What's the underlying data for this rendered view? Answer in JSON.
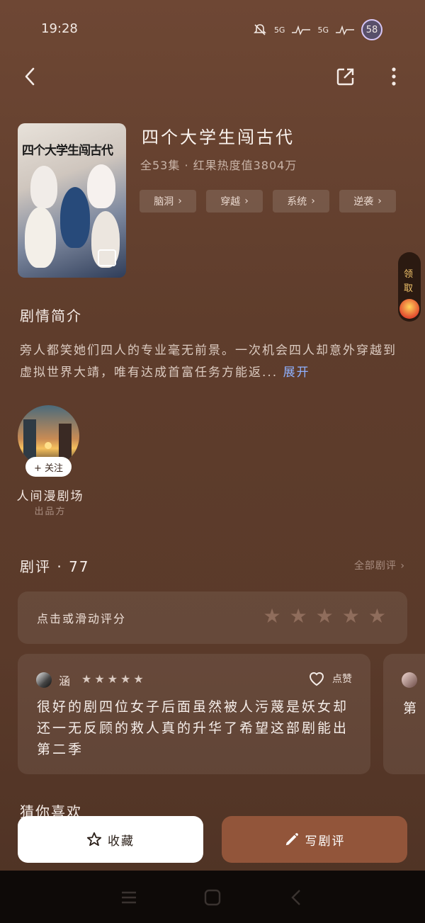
{
  "status_bar": {
    "time": "19:28",
    "net1": "5G",
    "net2": "5G",
    "battery": "58"
  },
  "drama": {
    "title": "四个大学生闯古代",
    "meta": "全53集 · 红果热度值3804万",
    "cover_title": "四个大学生闯古代",
    "tags": [
      "脑洞",
      "穿越",
      "系统",
      "逆袭"
    ]
  },
  "side_widget": {
    "label": "领取"
  },
  "synopsis": {
    "heading": "剧情简介",
    "text": "旁人都笑她们四人的专业毫无前景。一次机会四人却意外穿越到虚拟世界大靖，唯有达成首富任务方能返...",
    "expand": "展开"
  },
  "producer": {
    "follow": "+ 关注",
    "name": "人间漫剧场",
    "role": "出品方"
  },
  "reviews": {
    "heading": "剧评 · 77",
    "all_link": "全部剧评",
    "rate_prompt": "点击或滑动评分",
    "rate_stars_filled": 0,
    "items": [
      {
        "user": "涵",
        "stars": 5,
        "like": "点赞",
        "text": "很好的剧四位女子后面虽然被人污蔑是妖女却还一无反顾的救人真的升华了希望这部剧能出第二季"
      },
      {
        "text": "第"
      }
    ]
  },
  "guess": {
    "heading": "猜你喜欢"
  },
  "actions": {
    "favorite": "收藏",
    "write_review": "写剧评"
  },
  "colors": {
    "accent_button": "#92553a",
    "link": "#8fb1ff",
    "background": "#5f3d2c"
  }
}
